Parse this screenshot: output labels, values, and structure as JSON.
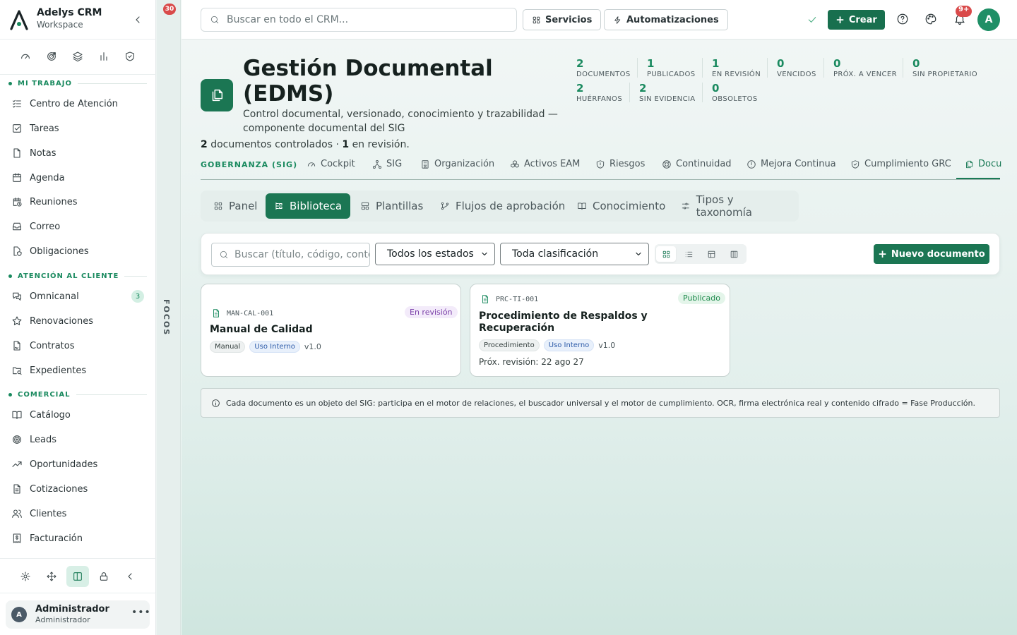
{
  "app": {
    "name": "Adelys CRM",
    "workspace": "Workspace"
  },
  "sidebar": {
    "sections": [
      {
        "label": "MI TRABAJO",
        "items": [
          {
            "label": "Centro de Atención",
            "icon": "list-check-icon"
          },
          {
            "label": "Tareas",
            "icon": "square-check-icon"
          },
          {
            "label": "Notas",
            "icon": "file-icon"
          },
          {
            "label": "Agenda",
            "icon": "calendar-icon"
          },
          {
            "label": "Reuniones",
            "icon": "calendar-clock-icon"
          },
          {
            "label": "Correo",
            "icon": "inbox-icon"
          },
          {
            "label": "Obligaciones",
            "icon": "file-shield-icon"
          }
        ]
      },
      {
        "label": "ATENCIÓN AL CLIENTE",
        "items": [
          {
            "label": "Omnicanal",
            "icon": "messages-icon",
            "badge": "3"
          },
          {
            "label": "Renovaciones",
            "icon": "star-icon"
          },
          {
            "label": "Contratos",
            "icon": "file-signature-icon"
          },
          {
            "label": "Expedientes",
            "icon": "folder-search-icon"
          }
        ]
      },
      {
        "label": "COMERCIAL",
        "items": [
          {
            "label": "Catálogo",
            "icon": "book-open-icon"
          },
          {
            "label": "Leads",
            "icon": "target-icon"
          },
          {
            "label": "Oportunidades",
            "icon": "trending-up-icon"
          },
          {
            "label": "Cotizaciones",
            "icon": "file-text-icon"
          },
          {
            "label": "Clientes",
            "icon": "users-icon"
          },
          {
            "label": "Facturación",
            "icon": "receipt-dollar-icon"
          }
        ]
      }
    ],
    "user": {
      "initial": "A",
      "name": "Administrador",
      "role": "Administrador"
    }
  },
  "focos": {
    "badge": "30",
    "label": "FOCOS"
  },
  "topbar": {
    "search_placeholder": "Buscar en todo el CRM...",
    "servicios": "Servicios",
    "automatizaciones": "Automatizaciones",
    "crear": "Crear",
    "notif_badge": "9+",
    "avatar": "A"
  },
  "page": {
    "title": "Gestión Documental (EDMS)",
    "subtitle": "Control documental, versionado, conocimiento y trazabilidad — componente documental del SIG",
    "summary": {
      "count": "2",
      "count_text": "documentos controlados · ",
      "review": "1",
      "review_text": "en revisión."
    },
    "stats": [
      {
        "value": "2",
        "label": "DOCUMENTOS"
      },
      {
        "value": "1",
        "label": "PUBLICADOS"
      },
      {
        "value": "1",
        "label": "EN REVISIÓN"
      },
      {
        "value": "0",
        "label": "VENCIDOS"
      },
      {
        "value": "0",
        "label": "PRÓX. A VENCER"
      },
      {
        "value": "0",
        "label": "SIN PROPIETARIO"
      },
      {
        "value": "2",
        "label": "HUÉRFANOS"
      },
      {
        "value": "2",
        "label": "SIN EVIDENCIA"
      },
      {
        "value": "0",
        "label": "OBSOLETOS"
      }
    ]
  },
  "gov": {
    "label": "GOBERNANZA (SIG)",
    "tabs": [
      {
        "label": "Cockpit",
        "icon": "gauge-icon"
      },
      {
        "label": "SIG",
        "icon": "network-icon"
      },
      {
        "label": "Organización",
        "icon": "building-icon"
      },
      {
        "label": "Activos EAM",
        "icon": "boxes-icon"
      },
      {
        "label": "Riesgos",
        "icon": "shield-alert-icon"
      },
      {
        "label": "Continuidad",
        "icon": "life-buoy-icon"
      },
      {
        "label": "Mejora Continua",
        "icon": "alert-circle-icon"
      },
      {
        "label": "Cumplimiento GRC",
        "icon": "shield-check-icon"
      },
      {
        "label": "Docu",
        "icon": "files-icon"
      }
    ]
  },
  "subtabs": [
    {
      "label": "Panel",
      "icon": "grid-icon"
    },
    {
      "label": "Biblioteca",
      "icon": "library-icon"
    },
    {
      "label": "Plantillas",
      "icon": "layout-template-icon"
    },
    {
      "label": "Flujos de aprobación",
      "icon": "git-branch-icon"
    },
    {
      "label": "Conocimiento",
      "icon": "book-open-icon"
    },
    {
      "label": "Tipos y taxonomía",
      "icon": "sliders-icon"
    }
  ],
  "library": {
    "search_placeholder": "Buscar (título, código, contenido)",
    "status_filter": "Todos los estados",
    "class_filter": "Toda clasificación",
    "new_button": "Nuevo documento"
  },
  "documents": [
    {
      "code": "MAN-CAL-001",
      "status": "En revisión",
      "title": "Manual de Calidad",
      "type": "Manual",
      "classification": "Uso Interno",
      "version": "v1.0"
    },
    {
      "code": "PRC-TI-001",
      "status": "Publicado",
      "title": "Procedimiento de Respaldos y Recuperación",
      "type": "Procedimiento",
      "classification": "Uso Interno",
      "version": "v1.0",
      "next_review": "Próx. revisión: 22 ago 27"
    }
  ],
  "note": "Cada documento es un objeto del SIG: participa en el motor de relaciones, el buscador universal y el motor de cumplimiento. OCR, firma electrónica real y contenido cifrado = Fase Producción.",
  "colors": {
    "primary": "#1b7653",
    "accent": "#1a8a5f",
    "danger": "#d94a4a",
    "review_purple": "#7a3fa8",
    "published_green": "#1f8a4c"
  }
}
